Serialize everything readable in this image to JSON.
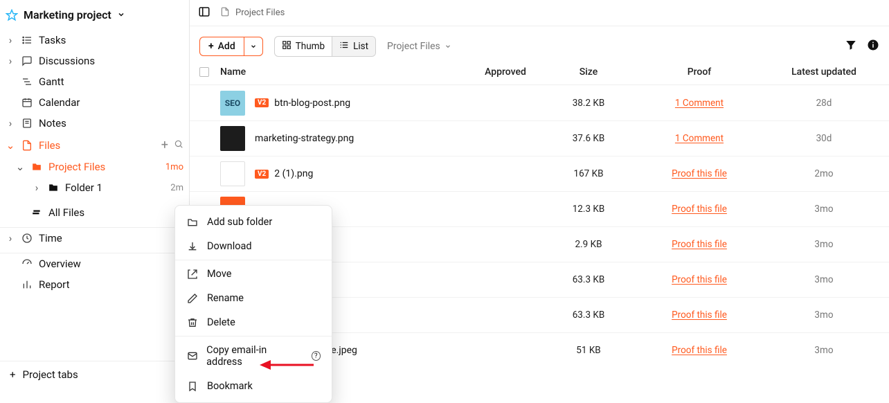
{
  "project_title": "Marketing project",
  "sidebar": {
    "items": [
      {
        "label": "Tasks",
        "caret": ">"
      },
      {
        "label": "Discussions",
        "caret": ">"
      },
      {
        "label": "Gantt",
        "caret": ""
      },
      {
        "label": "Calendar",
        "caret": ""
      },
      {
        "label": "Notes",
        "caret": ">"
      }
    ],
    "files_label": "Files",
    "project_files": {
      "label": "Project Files",
      "meta": "1mo"
    },
    "folder1": {
      "label": "Folder 1",
      "meta": "2m"
    },
    "all_files_label": "All Files",
    "time_label": "Time",
    "overview_label": "Overview",
    "report_label": "Report",
    "project_tabs_label": "Project tabs"
  },
  "topbar": {
    "breadcrumb": "Project Files"
  },
  "toolbar": {
    "add_label": "Add",
    "thumb_label": "Thumb",
    "list_label": "List",
    "selector_label": "Project Files"
  },
  "columns": {
    "name": "Name",
    "approved": "Approved",
    "size": "Size",
    "proof": "Proof",
    "updated": "Latest updated"
  },
  "rows": [
    {
      "version": "V2",
      "name": "btn-blog-post.png",
      "size": "38.2 KB",
      "proof": "1 Comment",
      "updated": "28d",
      "thumb": "seo",
      "thumbtext": "SEO"
    },
    {
      "version": "",
      "name": "marketing-strategy.png",
      "size": "37.6 KB",
      "proof": "1 Comment",
      "updated": "30d",
      "thumb": "dark",
      "thumbtext": ""
    },
    {
      "version": "V2",
      "name": "2 (1).png",
      "size": "167 KB",
      "proof": "Proof this file",
      "updated": "2mo",
      "thumb": "white",
      "thumbtext": ""
    },
    {
      "version": "",
      "name": "",
      "size": "12.3 KB",
      "proof": "Proof this file",
      "updated": "3mo",
      "thumb": "orange",
      "thumbtext": ""
    },
    {
      "version": "",
      "name": "",
      "size": "2.9 KB",
      "proof": "Proof this file",
      "updated": "3mo",
      "thumb": "",
      "thumbtext": ""
    },
    {
      "version": "",
      "name": "",
      "size": "63.3 KB",
      "proof": "Proof this file",
      "updated": "3mo",
      "thumb": "",
      "thumbtext": ""
    },
    {
      "version": "",
      "name": "",
      "size": "63.3 KB",
      "proof": "Proof this file",
      "updated": "3mo",
      "thumb": "",
      "thumbtext": ""
    },
    {
      "version": "",
      "name": "ent-Tools-Software.jpeg",
      "size": "51 KB",
      "proof": "Proof this file",
      "updated": "3mo",
      "thumb": "",
      "thumbtext": ""
    }
  ],
  "menu": {
    "add_sub": "Add sub folder",
    "download": "Download",
    "move": "Move",
    "rename": "Rename",
    "delete": "Delete",
    "copy_email": "Copy email-in address",
    "bookmark": "Bookmark"
  }
}
